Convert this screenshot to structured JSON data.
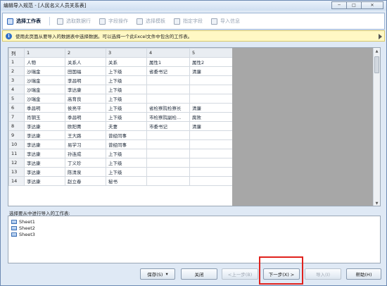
{
  "window": {
    "title": "编辑导入规范 - [人民名义人员关系表]",
    "controls": [
      "─",
      "□",
      "✕"
    ]
  },
  "steps": [
    {
      "label": "选择工作表",
      "active": true
    },
    {
      "label": "选取数据行",
      "active": false
    },
    {
      "label": "字段操作",
      "active": false
    },
    {
      "label": "选择模板",
      "active": false
    },
    {
      "label": "指定字段",
      "active": false
    },
    {
      "label": "导入信息",
      "active": false
    }
  ],
  "info": {
    "icon": "info-icon",
    "text": "使用此页面从要导入的数据表中选择数据。可以选择一个此Excel文件中包含的工作表。"
  },
  "grid": {
    "headers": [
      "列",
      "1",
      "2",
      "3",
      "4",
      "5"
    ],
    "rows": [
      [
        "1",
        "人物",
        "关系人",
        "关系",
        "属性1",
        "属性2"
      ],
      [
        "2",
        "沙瑞金",
        "田国福",
        "上下级",
        "省委书记",
        "清廉"
      ],
      [
        "3",
        "沙瑞金",
        "李昌明",
        "上下级",
        "",
        ""
      ],
      [
        "4",
        "沙瑞金",
        "李达康",
        "上下级",
        "",
        ""
      ],
      [
        "5",
        "沙瑞金",
        "高育良",
        "上下级",
        "",
        ""
      ],
      [
        "6",
        "季昌明",
        "侯亮平",
        "上下级",
        "省检察院检察长",
        "清廉"
      ],
      [
        "7",
        "肖钢玉",
        "季昌明",
        "上下级",
        "市检察院副检...",
        "腐败"
      ],
      [
        "8",
        "李达康",
        "欧阳菁",
        "夫妻",
        "市委书记",
        "清廉"
      ],
      [
        "9",
        "李达康",
        "王大路",
        "曾经同事",
        "",
        ""
      ],
      [
        "10",
        "李达康",
        "易学习",
        "曾经同事",
        "",
        ""
      ],
      [
        "11",
        "李达康",
        "孙连成",
        "上下级",
        "",
        ""
      ],
      [
        "12",
        "李达康",
        "丁义珍",
        "上下级",
        "",
        ""
      ],
      [
        "13",
        "李达康",
        "陈清泉",
        "上下级",
        "",
        ""
      ],
      [
        "14",
        "李达康",
        "赵立春",
        "秘书",
        "",
        ""
      ]
    ]
  },
  "sheets": {
    "label": "选择要从中进行导入的工作表:",
    "items": [
      "Sheet1",
      "Sheet2",
      "Sheet3"
    ]
  },
  "buttons": {
    "save": "保存(S)",
    "save_arrow": "▾",
    "close": "关闭",
    "prev": "<上一步(B)",
    "next": "下一步(X) >",
    "import": "导入(I)",
    "help": "帮助(H)"
  },
  "colors": {
    "accent": "#2f6fc9",
    "highlight": "#e0221d",
    "grid_empty": "#a7a7a7"
  }
}
